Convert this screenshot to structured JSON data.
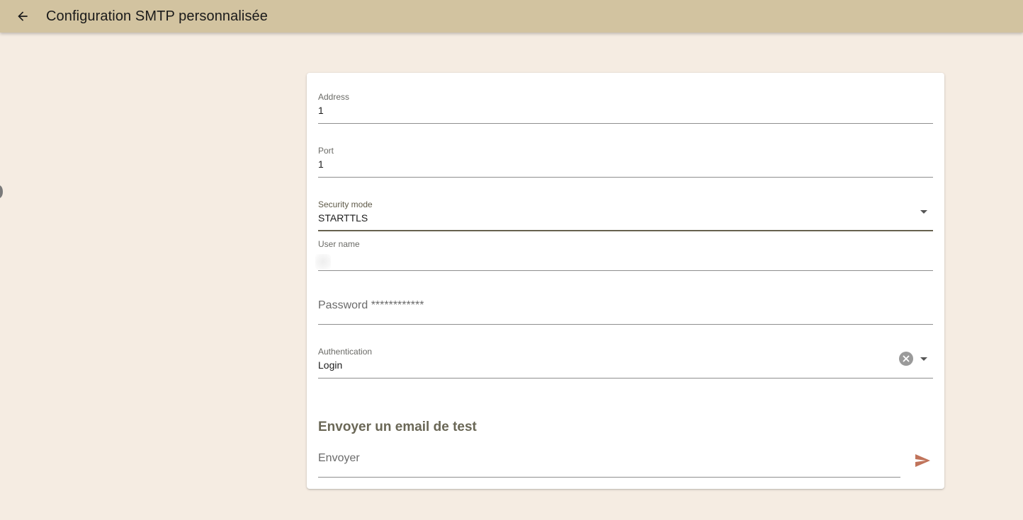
{
  "appbar": {
    "title": "Configuration SMTP personnalisée",
    "back_icon": "arrow-left-icon",
    "background": "#d2c3a0"
  },
  "form": {
    "address": {
      "label": "Address",
      "value": "1"
    },
    "port": {
      "label": "Port",
      "value": "1"
    },
    "security_mode": {
      "label": "Security mode",
      "value": "STARTTLS"
    },
    "user_name": {
      "label": "User name",
      "value": ""
    },
    "password": {
      "placeholder": "Password ************"
    },
    "authentication": {
      "label": "Authentication",
      "value": "Login"
    }
  },
  "test_email": {
    "title": "Envoyer un email de test",
    "placeholder": "Envoyer",
    "send_icon": "send-icon",
    "send_color": "#c0735a"
  },
  "colors": {
    "page_background": "#f5ece2",
    "active_underline": "#67614f"
  }
}
